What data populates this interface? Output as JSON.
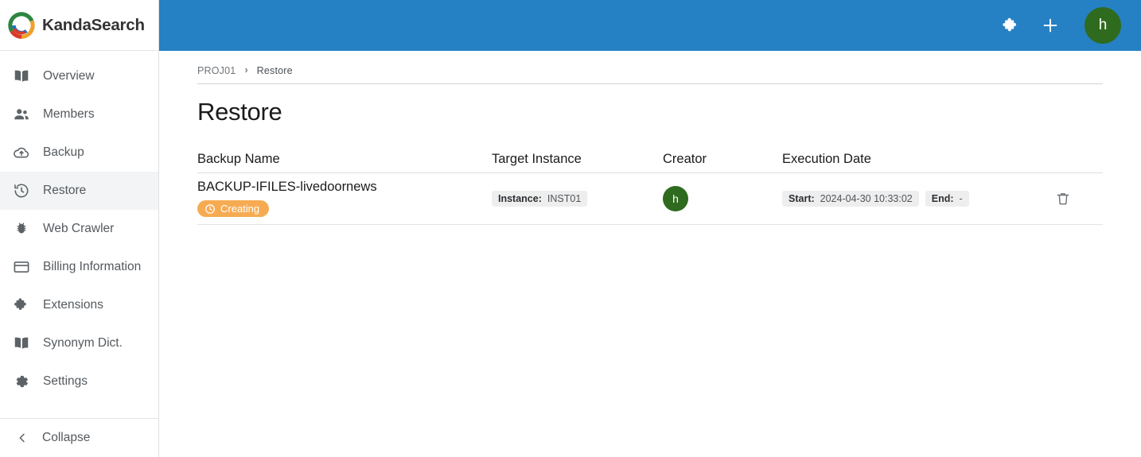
{
  "brand": {
    "name": "KandaSearch",
    "logo_icon": "kandasearch-swoosh-logo"
  },
  "colors": {
    "header_blue": "#2581c4",
    "avatar_green": "#2f6b1e",
    "badge_orange": "#f6ab52",
    "active_nav_bg": "#f3f4f5",
    "text_default": "#54595e"
  },
  "sidebar": {
    "items": [
      {
        "label": "Overview",
        "icon": "book-icon",
        "active": false
      },
      {
        "label": "Members",
        "icon": "people-icon",
        "active": false
      },
      {
        "label": "Backup",
        "icon": "cloud-upload-icon",
        "active": false
      },
      {
        "label": "Restore",
        "icon": "restore-clock-icon",
        "active": true
      },
      {
        "label": "Web Crawler",
        "icon": "bug-icon",
        "active": false
      },
      {
        "label": "Billing Information",
        "icon": "credit-card-icon",
        "active": false
      },
      {
        "label": "Extensions",
        "icon": "puzzle-icon",
        "active": false
      },
      {
        "label": "Synonym Dict.",
        "icon": "book-icon",
        "active": false
      },
      {
        "label": "Settings",
        "icon": "gear-icon",
        "active": false
      }
    ],
    "collapse": {
      "label": "Collapse",
      "icon": "chevron-left-icon"
    }
  },
  "topbar": {
    "extensions_icon": "puzzle-icon",
    "add_icon": "plus-icon",
    "avatar_initial": "h"
  },
  "breadcrumb": {
    "project": "PROJ01",
    "separator": "›",
    "current": "Restore"
  },
  "page": {
    "title": "Restore"
  },
  "table": {
    "headers": {
      "name": "Backup Name",
      "instance": "Target Instance",
      "creator": "Creator",
      "date": "Execution Date"
    },
    "rows": [
      {
        "backup_name": "BACKUP-IFILES-livedoornews",
        "status_badge": {
          "label": "Creating",
          "icon": "clock-icon"
        },
        "instance": {
          "label": "Instance:",
          "value": "INST01"
        },
        "creator_initial": "h",
        "start": {
          "label": "Start:",
          "value": "2024-04-30 10:33:02"
        },
        "end": {
          "label": "End:",
          "value": "-"
        },
        "delete_icon": "trash-icon"
      }
    ]
  }
}
